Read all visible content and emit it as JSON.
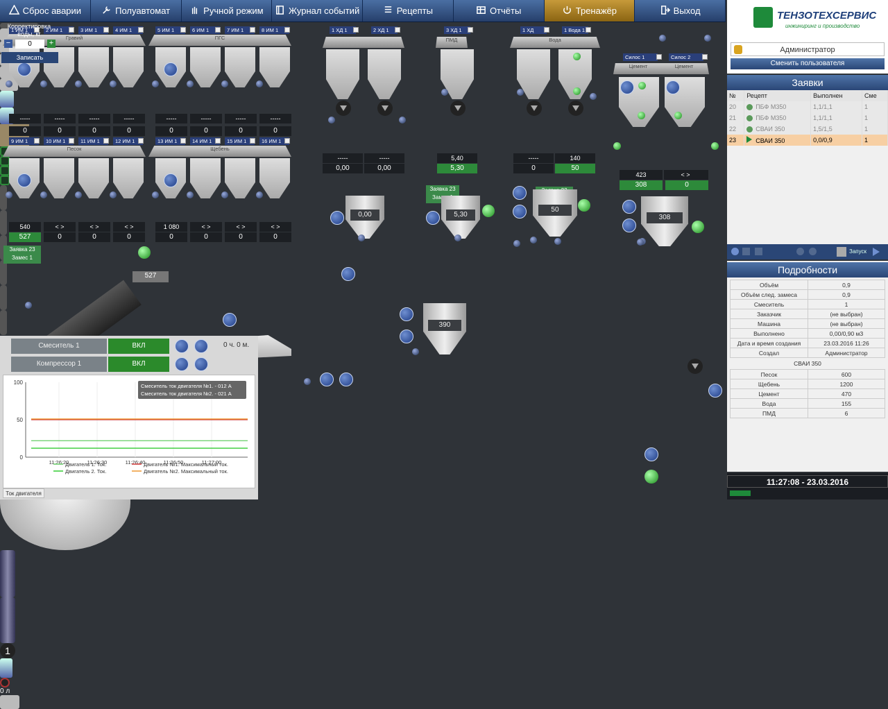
{
  "topbar": [
    {
      "label": "Сброс аварии",
      "icon": "warning-icon"
    },
    {
      "label": "Полуавтомат",
      "icon": "wrench-icon"
    },
    {
      "label": "Ручной режим",
      "icon": "hand-icon"
    },
    {
      "label": "Журнал событий",
      "icon": "book-icon"
    },
    {
      "label": "Рецепты",
      "icon": "list-icon"
    },
    {
      "label": "Отчёты",
      "icon": "table-icon"
    },
    {
      "label": "Тренажёр",
      "icon": "power-icon",
      "active": true
    },
    {
      "label": "Выход",
      "icon": "exit-icon"
    }
  ],
  "colors": {
    "accent": "#c79a3a",
    "navy": "#2a4676",
    "green": "#2d8a3a",
    "bg": "#2f3338",
    "highlight_row": "#f7cfa3"
  },
  "logo": {
    "title": "ТЕНЗОТЕХСЕРВИС",
    "subtitle": "инжиниринг и производство"
  },
  "user": {
    "name": "Администратор",
    "change_label": "Сменить пользователя"
  },
  "bins_top": {
    "labels": [
      "1 ИМ 1",
      "2 ИМ 1",
      "3 ИМ 1",
      "4 ИМ 1",
      "5 ИМ 1",
      "6 ИМ 1",
      "7 ИМ 1",
      "8 ИМ 1"
    ],
    "group_names": [
      "Гравий",
      "ПГС"
    ],
    "dash": [
      "-----",
      "-----",
      "-----",
      "-----",
      "-----",
      "-----",
      "-----",
      "-----"
    ],
    "values": [
      "0",
      "0",
      "0",
      "0",
      "0",
      "0",
      "0",
      "0"
    ]
  },
  "bins_bottom": {
    "labels": [
      "9 ИМ 1",
      "10 ИМ 1",
      "11 ИМ 1",
      "12 ИМ 1",
      "13 ИМ 1",
      "14 ИМ 1",
      "15 ИМ 1",
      "16 ИМ 1"
    ],
    "group_names": [
      "Песок",
      "Щебень"
    ],
    "set": [
      "540",
      "< >",
      "< >",
      "< >",
      "1 080",
      "< >",
      "< >",
      "< >"
    ],
    "values": [
      "527",
      "0",
      "0",
      "0",
      "0",
      "0",
      "0",
      "0"
    ]
  },
  "hd": {
    "labels": [
      "1 ХД 1",
      "2 ХД 1",
      "3 ХД 1",
      "1 ХД",
      "1 Вода 1"
    ],
    "sublabels": [
      "ПМД",
      "Вода"
    ]
  },
  "hd_values": {
    "set": [
      "-----",
      "-----",
      "5,40",
      "-----",
      "140"
    ],
    "act": [
      "0,00",
      "0,00",
      "5,30",
      "0",
      "50"
    ]
  },
  "silos": {
    "labels": [
      "Силос 1",
      "Силос 2"
    ],
    "sub": [
      "Цемент",
      "Цемент"
    ],
    "set": [
      "423",
      "< >"
    ],
    "act": [
      "308",
      "0"
    ]
  },
  "order_tag": {
    "line1": "Заявка 23",
    "line2": "Замес 1"
  },
  "weigh": [
    "0,00",
    "5,30",
    "50",
    "308",
    "390"
  ],
  "conveyor_value": "527",
  "water_correction": {
    "label": "Корректировка воды, кг",
    "value": "0",
    "save": "Записать"
  },
  "mixer_counter": "1",
  "drum_label": "0 л",
  "devices": [
    {
      "name": "Смеситель 1",
      "state": "ВКЛ"
    },
    {
      "name": "Компрессор 1",
      "state": "ВКЛ"
    }
  ],
  "timer": "0 ч. 0 м.",
  "chart_data": {
    "type": "line",
    "ylim": [
      0,
      100
    ],
    "yticks": [
      0,
      50,
      100
    ],
    "x": [
      "11:26:20",
      "11:26:30",
      "11:26:40",
      "11:26:50",
      "11:27:00"
    ],
    "series": [
      {
        "name": "Двигатель 1. Ток.",
        "color": "#6c6",
        "values": [
          22,
          22,
          22,
          22,
          22,
          22
        ]
      },
      {
        "name": "Двигатель 2. Ток.",
        "color": "#3c3",
        "values": [
          12,
          12,
          12,
          12,
          12,
          12
        ]
      },
      {
        "name": "Двигатель №1. Максимальный ток.",
        "color": "#c33",
        "values": [
          50,
          50,
          50,
          50,
          50,
          50
        ]
      },
      {
        "name": "Двигатель №2. Максимальный ток.",
        "color": "#e93",
        "values": [
          51,
          51,
          51,
          51,
          51,
          51
        ]
      }
    ],
    "tooltip": [
      "Смеситель ток двигателя №1. - 012 А",
      "Смеситель ток двигателя №2. - 021 А"
    ],
    "tab": "Ток двигателя"
  },
  "orders": {
    "title": "Заявки",
    "columns": [
      "№",
      "Рецепт",
      "Выполнен",
      "Сме"
    ],
    "rows": [
      {
        "n": "20",
        "recipe": "ПБФ М350",
        "done": "1,1/1,1",
        "m": "1",
        "state": "done"
      },
      {
        "n": "21",
        "recipe": "ПБФ М350",
        "done": "1,1/1,1",
        "m": "1",
        "state": "done"
      },
      {
        "n": "22",
        "recipe": "СВАИ 350",
        "done": "1,5/1,5",
        "m": "1",
        "state": "done"
      },
      {
        "n": "23",
        "recipe": "СВАИ 350",
        "done": "0,0/0,9",
        "m": "1",
        "state": "active"
      }
    ],
    "run_label": "Запуск"
  },
  "details": {
    "title": "Подробности",
    "rows": [
      [
        "Объём",
        "0,9"
      ],
      [
        "Объём след. замеса",
        "0,9"
      ],
      [
        "Смеситель",
        "1"
      ],
      [
        "Заказчик",
        "(не выбран)"
      ],
      [
        "Машина",
        "(не выбран)"
      ],
      [
        "Выполнено",
        "0,00/0,90 м3"
      ],
      [
        "Дата и время создания",
        "23.03.2016 11:26"
      ],
      [
        "Создал",
        "Администратор"
      ]
    ],
    "recipe_name": "СВАИ 350",
    "recipe_rows": [
      [
        "Песок",
        "600"
      ],
      [
        "Щебень",
        "1200"
      ],
      [
        "Цемент",
        "470"
      ],
      [
        "Вода",
        "155"
      ],
      [
        "ПМД",
        "6"
      ]
    ]
  },
  "clock": "11:27:08 - 23.03.2016"
}
